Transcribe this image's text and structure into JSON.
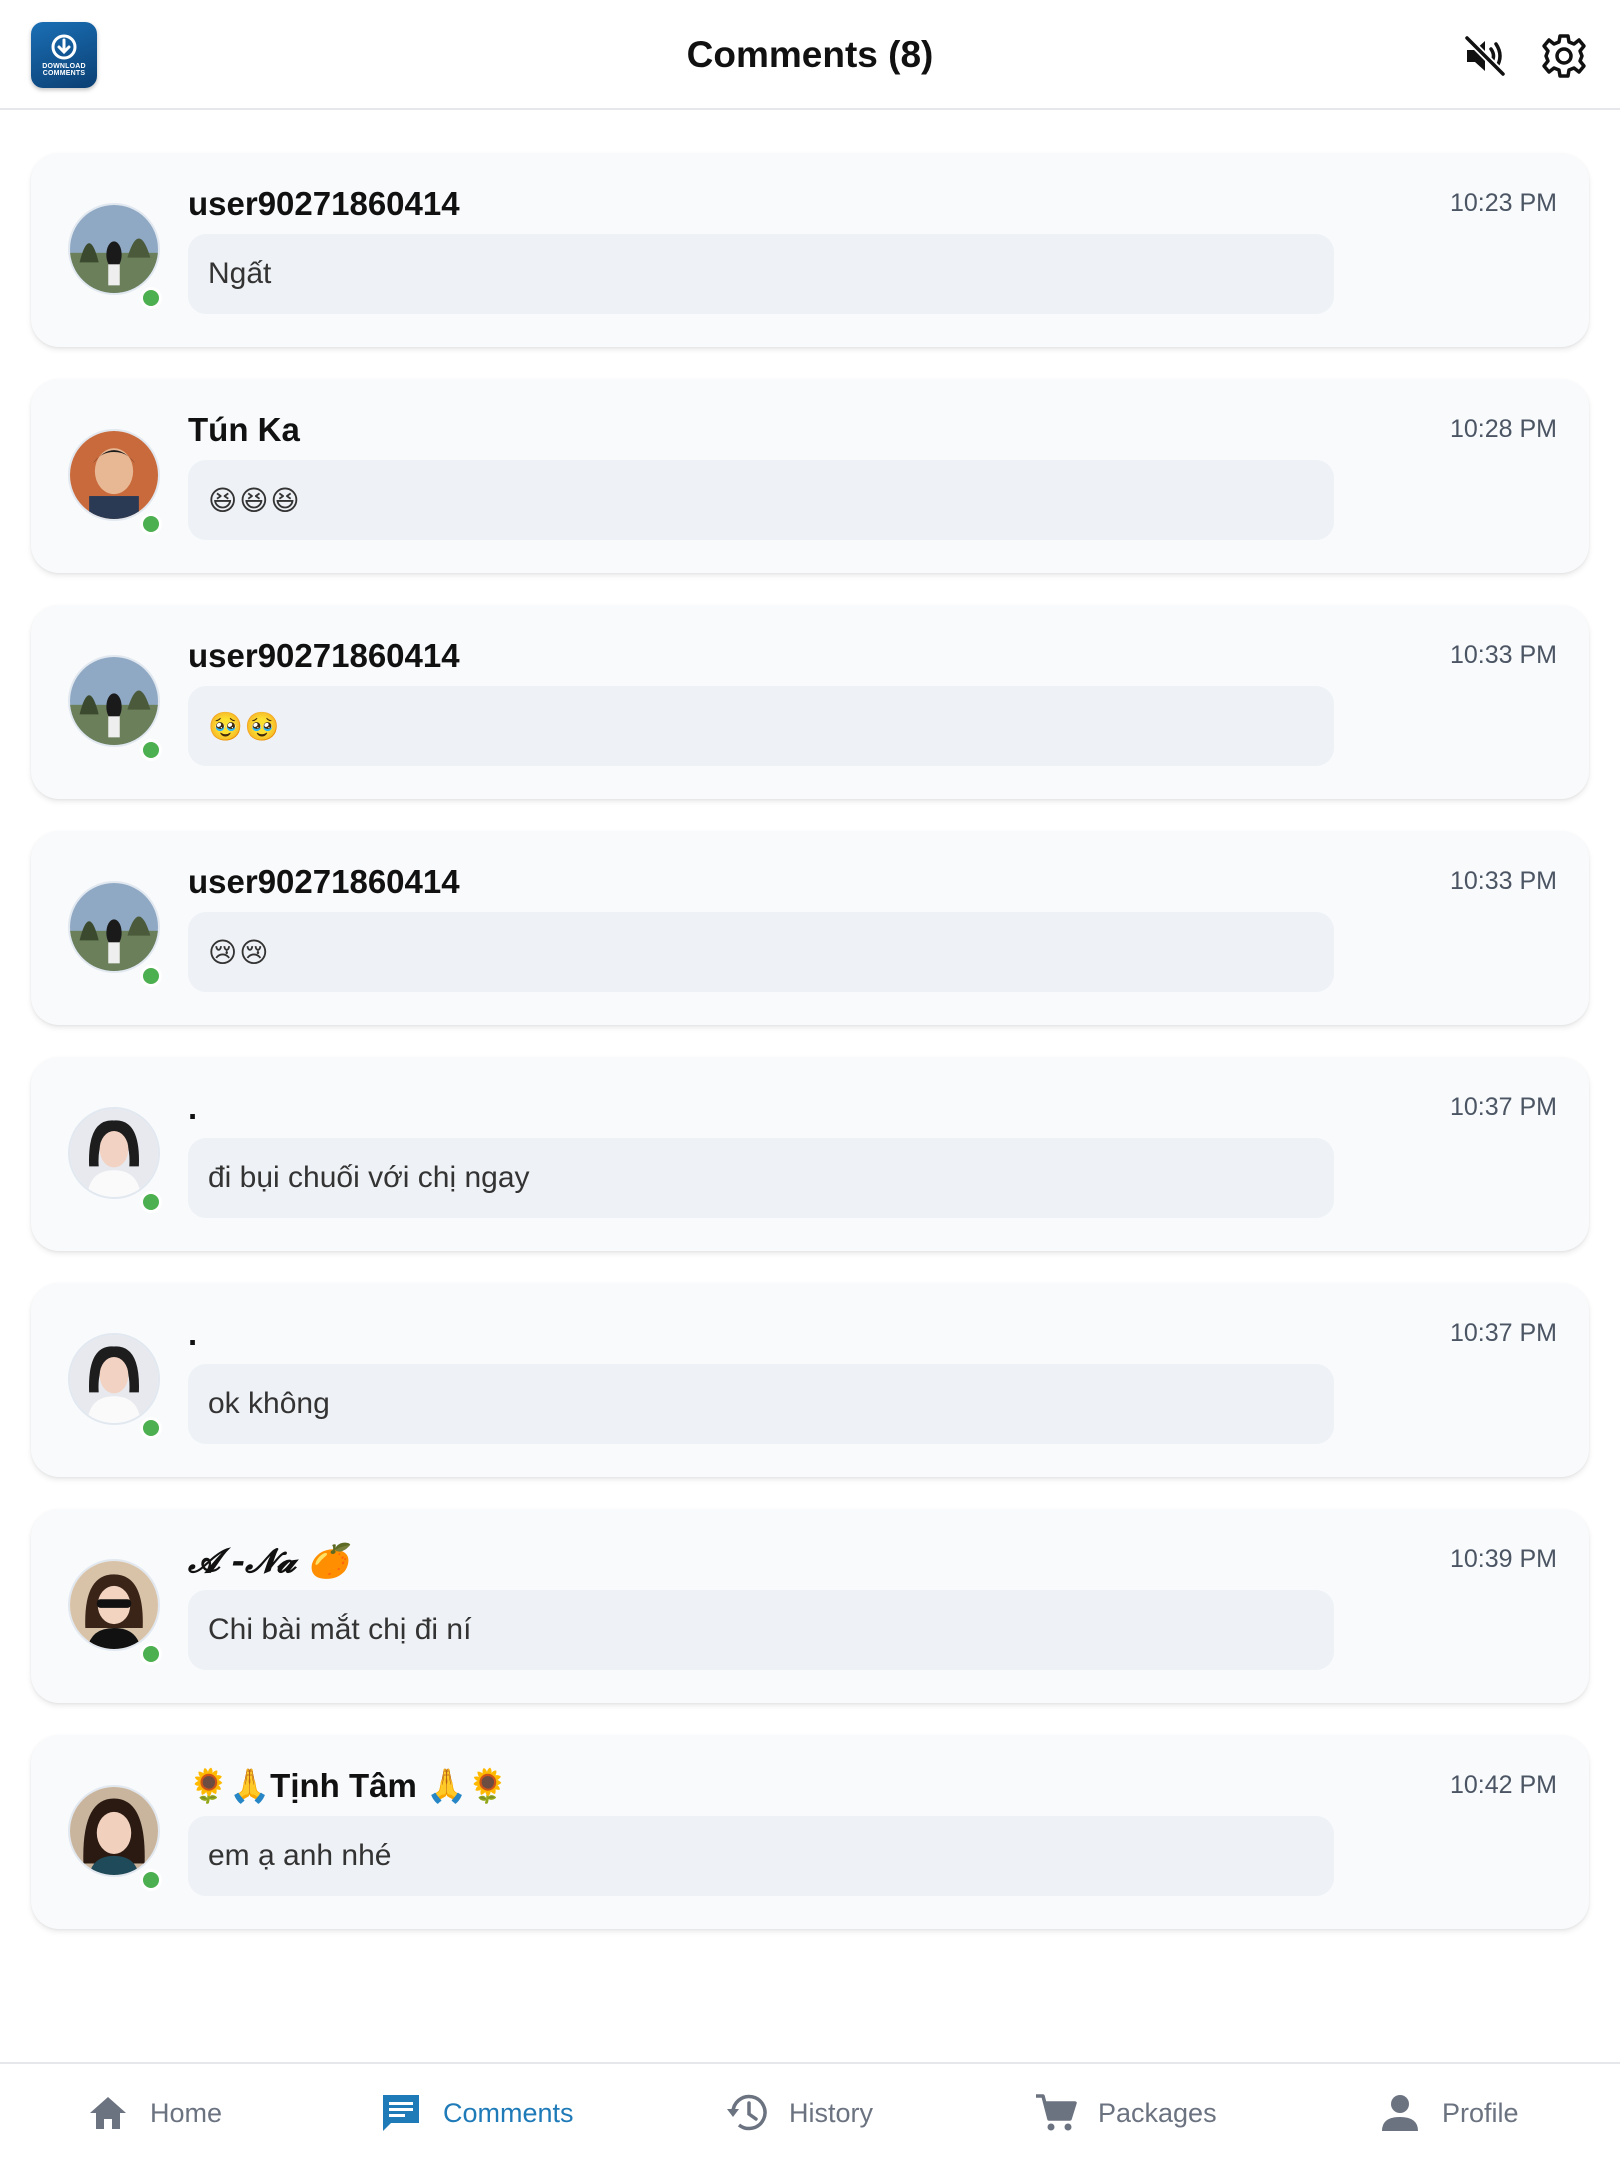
{
  "header": {
    "title": "Comments (8)",
    "logo_line1": "DOWNLOAD",
    "logo_line2": "COMMENTS",
    "icons": [
      "mute-icon",
      "gear-icon"
    ]
  },
  "comments": [
    {
      "user": "user90271860414",
      "time": "10:23 PM",
      "text": "Ngất"
    },
    {
      "user": "Tún Ka",
      "time": "10:28 PM",
      "text": "😆😆😆"
    },
    {
      "user": "user90271860414",
      "time": "10:33 PM",
      "text": "🥹🥹"
    },
    {
      "user": "user90271860414",
      "time": "10:33 PM",
      "text": "😢😢"
    },
    {
      "user": ".",
      "time": "10:37 PM",
      "text": "đi bụi chuối với chị ngay"
    },
    {
      "user": ".",
      "time": "10:37 PM",
      "text": "ok không"
    },
    {
      "user": "𝓐 -𝓝𝓪 🍊",
      "time": "10:39 PM",
      "text": "Chi bài mắt chị đi ní"
    },
    {
      "user": "🌻🙏Tịnh Tâm 🙏🌻",
      "time": "10:42 PM",
      "text": "em ạ anh nhé"
    }
  ],
  "nav": [
    {
      "label": "Home",
      "icon": "home-icon",
      "active": false
    },
    {
      "label": "Comments",
      "icon": "comments-icon",
      "active": true
    },
    {
      "label": "History",
      "icon": "history-icon",
      "active": false
    },
    {
      "label": "Packages",
      "icon": "cart-icon",
      "active": false
    },
    {
      "label": "Profile",
      "icon": "person-icon",
      "active": false
    }
  ],
  "colors": {
    "accent": "#1f7ab8",
    "online": "#4caf50",
    "card_bg": "#f8fafc",
    "bubble_bg": "#eef1f5"
  }
}
